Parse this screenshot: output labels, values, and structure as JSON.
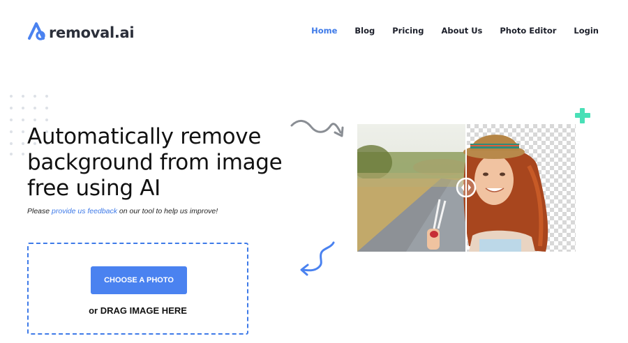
{
  "brand": {
    "name": "removal.ai"
  },
  "nav": {
    "items": [
      {
        "label": "Home",
        "active": true
      },
      {
        "label": "Blog"
      },
      {
        "label": "Pricing"
      },
      {
        "label": "About Us"
      },
      {
        "label": "Photo Editor"
      },
      {
        "label": "Login"
      }
    ]
  },
  "hero": {
    "headline_lines": [
      "Automatically remove",
      "background from image",
      "free using AI"
    ],
    "sub_prefix": "Please ",
    "sub_link": "provide us feedback",
    "sub_suffix": " on our tool to help us improve!"
  },
  "upload": {
    "button_label": "CHOOSE A PHOTO",
    "drag_label": "or DRAG IMAGE HERE"
  },
  "colors": {
    "accent": "#3e7ae8",
    "button": "#4a82f0",
    "plus_mint": "#49e0b7"
  },
  "icons": [
    "logo-icon",
    "handle-arrows-icon",
    "plus-icon",
    "squiggle-arrow-icon"
  ]
}
